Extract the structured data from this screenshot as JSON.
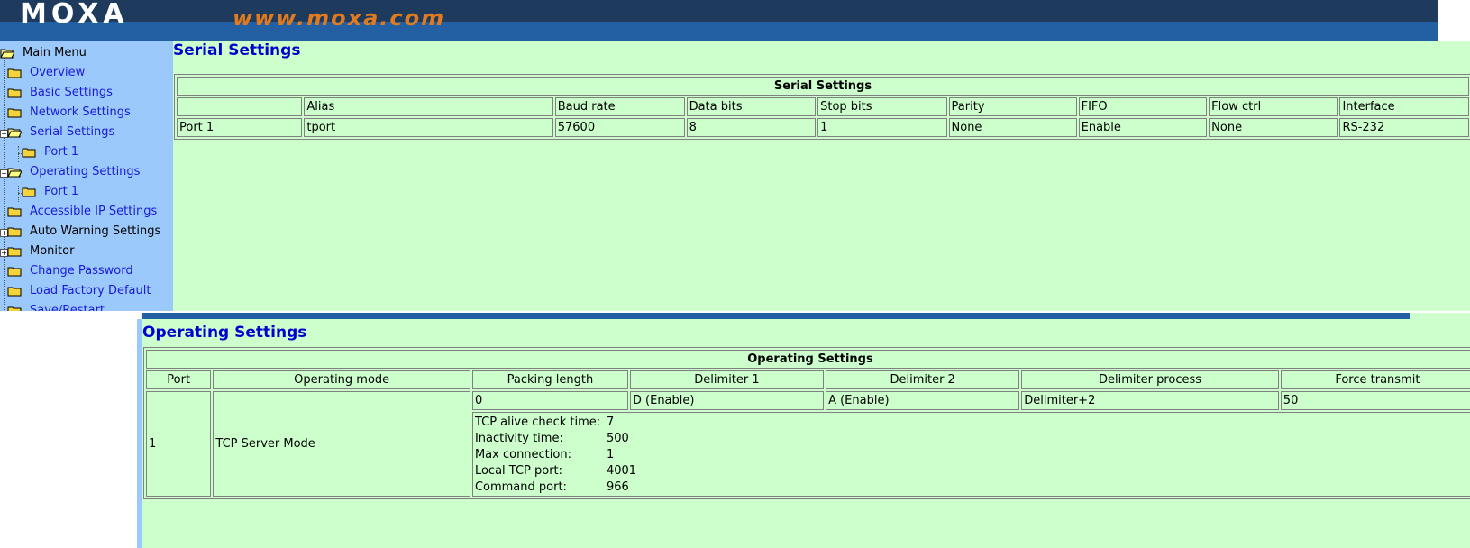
{
  "banner": {
    "logo": "MOXA",
    "url": "www.moxa.com"
  },
  "sidebar": {
    "items": [
      {
        "label": "Main Menu"
      },
      {
        "label": "Overview"
      },
      {
        "label": "Basic Settings"
      },
      {
        "label": "Network Settings"
      },
      {
        "label": "Serial Settings"
      },
      {
        "label": "Port 1"
      },
      {
        "label": "Operating Settings"
      },
      {
        "label": "Port 1"
      },
      {
        "label": "Accessible IP Settings"
      },
      {
        "label": "Auto Warning Settings"
      },
      {
        "label": "Monitor"
      },
      {
        "label": "Change Password"
      },
      {
        "label": "Load Factory Default"
      },
      {
        "label": "Save/Restart"
      }
    ]
  },
  "serial": {
    "page_title": "Serial Settings",
    "table_caption": "Serial Settings",
    "headers": [
      "",
      "Alias",
      "Baud rate",
      "Data bits",
      "Stop bits",
      "Parity",
      "FIFO",
      "Flow ctrl",
      "Interface"
    ],
    "row": [
      "Port 1",
      "tport",
      "57600",
      "8",
      "1",
      "None",
      "Enable",
      "None",
      "RS-232"
    ]
  },
  "operating": {
    "page_title": "Operating Settings",
    "table_caption": "Operating Settings",
    "headers": [
      "Port",
      "Operating mode",
      "Packing length",
      "Delimiter 1",
      "Delimiter 2",
      "Delimiter process",
      "Force transmit"
    ],
    "port": "1",
    "mode": "TCP Server Mode",
    "packing_length": "0",
    "delimiter1": "D (Enable)",
    "delimiter2": "A (Enable)",
    "delimiter_process": "Delimiter+2",
    "force_transmit": "50",
    "details": [
      {
        "key": "TCP alive check time:",
        "value": "7"
      },
      {
        "key": "Inactivity time:",
        "value": "500"
      },
      {
        "key": "Max connection:",
        "value": "1"
      },
      {
        "key": "Local TCP port:",
        "value": "4001"
      },
      {
        "key": "Command port:",
        "value": "966"
      }
    ]
  }
}
